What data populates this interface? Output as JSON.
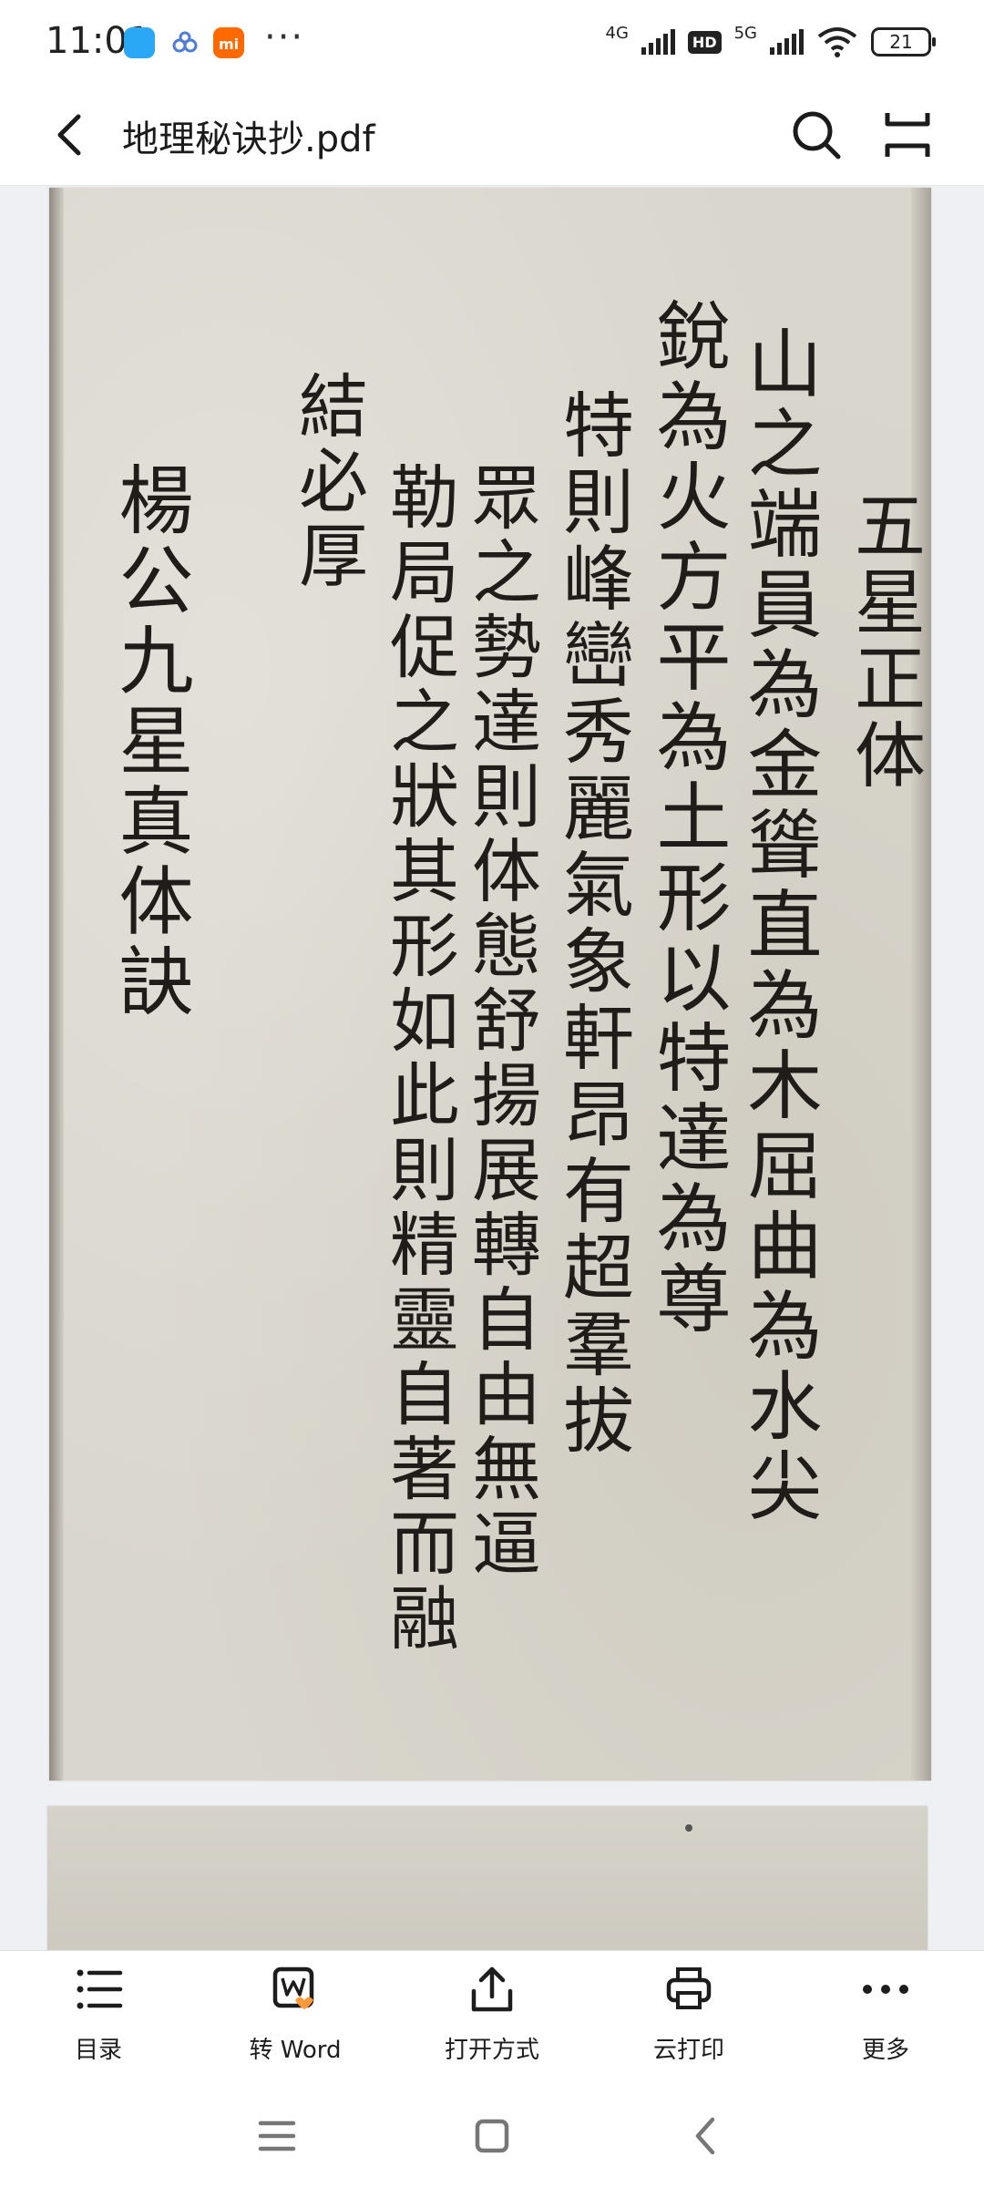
{
  "status_bar": {
    "time": "11:01",
    "net1": "4G",
    "hd": "HD",
    "net2": "5G",
    "battery": "21",
    "more": "···"
  },
  "header": {
    "title": "地理秘诀抄.pdf",
    "icons": [
      "back-arrow-icon",
      "search-icon",
      "double-bar-icon"
    ]
  },
  "page": {
    "lines": {
      "title": "五星正体",
      "l1": "山之端員為金聳直為木屈曲為水尖",
      "l2": "銳為火方平為土形以特達為尊",
      "l3": "特則峰巒秀麗氣象軒昂有超羣拔",
      "l4": "眾之勢達則体態舒揚展轉自由無逼",
      "l5": "勒局促之狀其形如此則精靈自著而融",
      "l6": "結必厚",
      "l7": "楊公九星真体訣"
    }
  },
  "toolbar": {
    "items": [
      {
        "label": "目录",
        "icon": "list-icon"
      },
      {
        "label": "转 Word",
        "icon": "word-convert-icon"
      },
      {
        "label": "打开方式",
        "icon": "share-icon"
      },
      {
        "label": "云打印",
        "icon": "printer-icon"
      },
      {
        "label": "更多",
        "icon": "more-dots-icon"
      }
    ]
  },
  "navbar": {
    "icons": [
      "menu-lines-icon",
      "home-square-icon",
      "back-chevron-icon"
    ]
  },
  "colors": {
    "accent_blue": "#2aa8f5",
    "mi_orange": "#ff6a00",
    "paper": "#d9d6cd",
    "ink": "#1f1c19"
  }
}
